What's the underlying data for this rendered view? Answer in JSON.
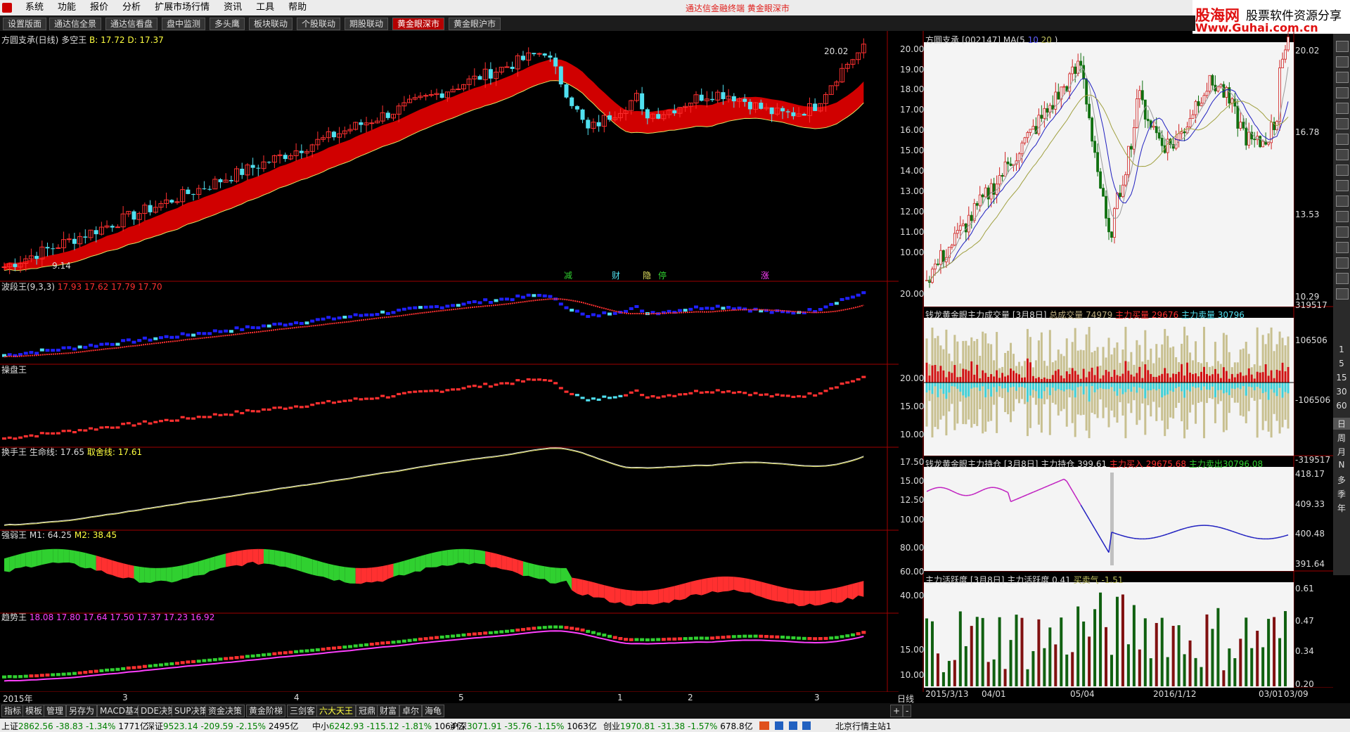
{
  "menubar": {
    "items": [
      "系统",
      "功能",
      "报价",
      "分析",
      "扩展市场行情",
      "资讯",
      "工具",
      "帮助"
    ],
    "title": "通达信金融终端    黄金眼深市"
  },
  "brand": {
    "name": "股海网",
    "tagline": "股票软件资源分享",
    "url": "Www.Guhai.com.cn"
  },
  "tabs": [
    "设置版面",
    "通达信全景",
    "通达信看盘",
    "盘中监测",
    "多头鹰",
    "板块联动",
    "个股联动",
    "期股联动",
    "黄金眼深市",
    "黄金眼沪市"
  ],
  "active_tab": "黄金眼深市",
  "left_panels": {
    "main": {
      "name": "方圆支承(日线)",
      "sub": "多空王",
      "b_label": "B: 17.72",
      "d_label": "D: 17.37",
      "price_high": "20.02",
      "price_low": "9.14",
      "axis": [
        "20.00",
        "19.00",
        "18.00",
        "17.00",
        "16.00",
        "15.00",
        "14.00",
        "13.00",
        "12.00",
        "11.00",
        "10.00"
      ],
      "markers": [
        "减",
        "财",
        "隐",
        "停",
        "涨"
      ]
    },
    "boduan": {
      "name": "波段王(9,3,3)",
      "values": [
        "17.93",
        "17.62",
        "17.79",
        "17.70"
      ],
      "axis": [
        "20.00"
      ]
    },
    "caopan": {
      "name": "操盘王",
      "axis": [
        "20.00",
        "15.00",
        "10.00"
      ]
    },
    "huanshou": {
      "name": "换手王",
      "label1": "生命线: 17.65",
      "label2": "取舍线: 17.61",
      "axis": [
        "17.50",
        "15.00",
        "12.50",
        "10.00"
      ]
    },
    "qiangruo": {
      "name": "强弱王",
      "m1": "M1: 64.25",
      "m2": "M2: 38.45",
      "axis": [
        "80.00",
        "60.00",
        "40.00"
      ]
    },
    "qushi": {
      "name": "趋势王",
      "values": [
        "18.08",
        "17.80",
        "17.64",
        "17.50",
        "17.37",
        "17.23",
        "16.92"
      ],
      "axis": [
        "15.00",
        "10.00"
      ]
    }
  },
  "date_axis": [
    "2015年",
    "3",
    "4",
    "5",
    "1",
    "2",
    "3"
  ],
  "period_label": "日线",
  "right_panels": {
    "main": {
      "name": "方圆支承",
      "code": "[002147]",
      "ma": "MA(",
      "ma_vals": [
        "5",
        "10",
        "20"
      ],
      "ma_close": ")",
      "axis": [
        "20.02",
        "16.78",
        "13.53",
        "10.29"
      ]
    },
    "volume": {
      "name": "钱龙黄金眼主力成交量 [3月8日]",
      "total": "总成交量 74979",
      "buy": "主力买量 29676",
      "sell": "主力卖量 30796",
      "axis": [
        "319517",
        "106506",
        "-106506",
        "-319517"
      ]
    },
    "hold": {
      "name": "钱龙黄金眼主力持仓 [3月8日]",
      "hold": "主力持仓 399.61",
      "buy": "主力买入 29675.68",
      "sell": "主力卖出30796.08",
      "axis": [
        "418.17",
        "409.33",
        "400.48",
        "391.64"
      ]
    },
    "active": {
      "name": "主力活跃度 [3月8日]",
      "act": "主力活跃度 0.41",
      "sell": "买卖气 -1.51",
      "axis": [
        "0.61",
        "0.47",
        "0.34",
        "0.20"
      ]
    },
    "date_axis": [
      "2015/3/13",
      "04/01",
      "05/04",
      "2016/1/12",
      "03/01",
      "03/09"
    ]
  },
  "right_toolbar": [
    "1",
    "5",
    "15",
    "30",
    "60",
    "日",
    "周",
    "月",
    "N",
    "多",
    "季",
    "年"
  ],
  "bottom_buttons": [
    "指标",
    "模板",
    "管理",
    "另存为",
    "MACD基本",
    "DDE决策",
    "SUP决策",
    "资金决策",
    "黄金阶梯",
    "三剑客",
    "六大天王",
    "冠鼎",
    "财富",
    "卓尔",
    "海龟"
  ],
  "status": [
    {
      "name": "上证",
      "price": "2862.56",
      "chg": "-38.83",
      "pct": "-1.34%",
      "amt": "1771亿"
    },
    {
      "name": "深证",
      "price": "9523.14",
      "chg": "-209.59",
      "pct": "-2.15%",
      "amt": "2495亿"
    },
    {
      "name": "中小",
      "price": "6242.93",
      "chg": "-115.12",
      "pct": "-1.81%",
      "amt": "1064亿"
    },
    {
      "name": "沪深",
      "price": "3071.91",
      "chg": "-35.76",
      "pct": "-1.15%",
      "amt": "1063亿"
    },
    {
      "name": "创业",
      "price": "1970.81",
      "chg": "-31.38",
      "pct": "-1.57%",
      "amt": "678.8亿"
    }
  ],
  "server": "北京行情主站1",
  "colors": {
    "up": "#ff3030",
    "down": "#50e0f0",
    "ribbon": "#d00000",
    "green": "#30d030",
    "pink": "#ff40ff",
    "yellow": "#e0e060"
  }
}
